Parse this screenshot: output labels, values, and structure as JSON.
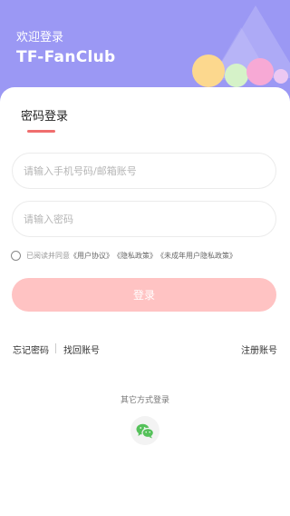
{
  "header": {
    "welcome": "欢迎登录",
    "brand": "TF-FanClub"
  },
  "login": {
    "tab_title": "密码登录",
    "account_placeholder": "请输入手机号码/邮箱账号",
    "password_placeholder": "请输入密码",
    "agree_prefix": "已阅读并同意",
    "user_agreement": "《用户协议》",
    "privacy_policy": "《隐私政策》",
    "minor_policy": "《未成年用户隐私政策》",
    "login_button": "登录",
    "forgot_password": "忘记密码",
    "recover_account": "找回账号",
    "register": "注册账号",
    "other_methods": "其它方式登录"
  },
  "colors": {
    "header_bg": "#9b98f4",
    "accent": "#f06e6e",
    "login_button_disabled": "#ffc3c3",
    "wechat_green": "#55c15a"
  },
  "icons": {
    "wechat": "wechat-icon"
  }
}
